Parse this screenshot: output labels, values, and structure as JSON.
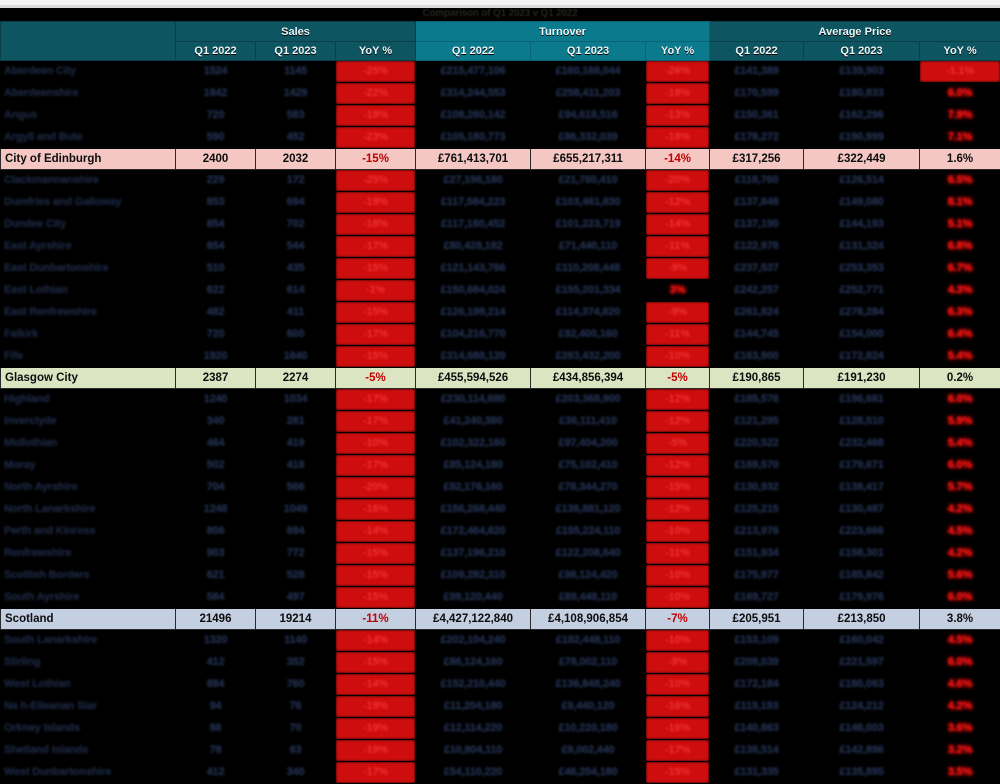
{
  "title": "Comparison of Q1 2023 v Q1 2022",
  "header": {
    "corner_label": "",
    "groups": [
      {
        "id": "sales",
        "label": "Sales"
      },
      {
        "id": "turnover",
        "label": "Turnover"
      },
      {
        "id": "average_price",
        "label": "Average Price"
      }
    ],
    "subcolumns": [
      "Q1 2022",
      "Q1 2023",
      "YoY %"
    ]
  },
  "colors": {
    "header_dark_teal": "#0d5560",
    "header_bright_teal": "#0b7a8c",
    "highlight_pink": "#f4c7c3",
    "highlight_green": "#dbe5c2",
    "highlight_blue": "#c5cfe2",
    "negative_red": "#c00000",
    "obscured_black": "#000000"
  },
  "rows": [
    {
      "type": "obscured",
      "name": "Aberdeen City",
      "cells": [
        "1524",
        "1145",
        "-25%",
        "£215,477,106",
        "£160,188,044",
        "-26%",
        "£141,389",
        "£139,903",
        "-1.1%"
      ]
    },
    {
      "type": "obscured",
      "name": "Aberdeenshire",
      "cells": [
        "1842",
        "1429",
        "-22%",
        "£314,244,553",
        "£258,411,203",
        "-18%",
        "£170,599",
        "£180,833",
        "6.0%"
      ]
    },
    {
      "type": "obscured",
      "name": "Angus",
      "cells": [
        "720",
        "583",
        "-19%",
        "£108,260,142",
        "£94,618,516",
        "-13%",
        "£150,361",
        "£162,296",
        "7.9%"
      ]
    },
    {
      "type": "obscured",
      "name": "Argyll and Bute",
      "cells": [
        "590",
        "452",
        "-23%",
        "£105,180,773",
        "£86,332,039",
        "-18%",
        "£178,272",
        "£190,999",
        "7.1%"
      ]
    },
    {
      "type": "highlight",
      "style": "pink",
      "name": "City of Edinburgh",
      "cells": [
        "2400",
        "2032",
        "-15%",
        "£761,413,701",
        "£655,217,311",
        "-14%",
        "£317,256",
        "£322,449",
        "1.6%"
      ]
    },
    {
      "type": "obscured",
      "name": "Clackmannanshire",
      "cells": [
        "229",
        "172",
        "-25%",
        "£27,196,180",
        "£21,760,410",
        "-20%",
        "£118,760",
        "£126,514",
        "6.5%"
      ]
    },
    {
      "type": "obscured",
      "name": "Dumfries and Galloway",
      "cells": [
        "853",
        "694",
        "-19%",
        "£117,584,223",
        "£103,461,830",
        "-12%",
        "£137,848",
        "£149,080",
        "8.1%"
      ]
    },
    {
      "type": "obscured",
      "name": "Dundee City",
      "cells": [
        "854",
        "702",
        "-18%",
        "£117,160,452",
        "£101,223,719",
        "-14%",
        "£137,190",
        "£144,193",
        "5.1%"
      ]
    },
    {
      "type": "obscured",
      "name": "East Ayrshire",
      "cells": [
        "654",
        "544",
        "-17%",
        "£80,428,182",
        "£71,440,110",
        "-11%",
        "£122,978",
        "£131,324",
        "6.8%"
      ]
    },
    {
      "type": "obscured",
      "name": "East Dunbartonshire",
      "cells": [
        "510",
        "435",
        "-15%",
        "£121,143,766",
        "£110,208,448",
        "-9%",
        "£237,537",
        "£253,353",
        "6.7%"
      ]
    },
    {
      "type": "obscured",
      "name": "East Lothian",
      "cells": [
        "622",
        "614",
        "-1%",
        "£150,684,024",
        "£155,201,334",
        "3%",
        "£242,257",
        "£252,771",
        "4.3%"
      ]
    },
    {
      "type": "obscured",
      "name": "East Renfrewshire",
      "cells": [
        "482",
        "411",
        "-15%",
        "£126,199,214",
        "£114,374,820",
        "-9%",
        "£261,824",
        "£278,284",
        "6.3%"
      ]
    },
    {
      "type": "obscured",
      "name": "Falkirk",
      "cells": [
        "720",
        "600",
        "-17%",
        "£104,216,770",
        "£92,400,160",
        "-11%",
        "£144,745",
        "£154,000",
        "6.4%"
      ]
    },
    {
      "type": "obscured",
      "name": "Fife",
      "cells": [
        "1920",
        "1640",
        "-15%",
        "£314,688,120",
        "£283,432,200",
        "-10%",
        "£163,900",
        "£172,824",
        "5.4%"
      ]
    },
    {
      "type": "highlight",
      "style": "green",
      "name": "Glasgow City",
      "cells": [
        "2387",
        "2274",
        "-5%",
        "£455,594,526",
        "£434,856,394",
        "-5%",
        "£190,865",
        "£191,230",
        "0.2%"
      ]
    },
    {
      "type": "obscured",
      "name": "Highland",
      "cells": [
        "1240",
        "1034",
        "-17%",
        "£230,114,880",
        "£203,368,900",
        "-12%",
        "£185,576",
        "£196,681",
        "6.0%"
      ]
    },
    {
      "type": "obscured",
      "name": "Inverclyde",
      "cells": [
        "340",
        "281",
        "-17%",
        "£41,240,380",
        "£36,111,410",
        "-12%",
        "£121,295",
        "£128,510",
        "5.9%"
      ]
    },
    {
      "type": "obscured",
      "name": "Midlothian",
      "cells": [
        "464",
        "419",
        "-10%",
        "£102,322,160",
        "£97,404,200",
        "-5%",
        "£220,522",
        "£232,468",
        "5.4%"
      ]
    },
    {
      "type": "obscured",
      "name": "Moray",
      "cells": [
        "502",
        "418",
        "-17%",
        "£85,124,180",
        "£75,102,410",
        "-12%",
        "£169,570",
        "£179,671",
        "6.0%"
      ]
    },
    {
      "type": "obscured",
      "name": "North Ayrshire",
      "cells": [
        "704",
        "566",
        "-20%",
        "£92,176,160",
        "£78,344,270",
        "-15%",
        "£130,932",
        "£138,417",
        "5.7%"
      ]
    },
    {
      "type": "obscured",
      "name": "North Lanarkshire",
      "cells": [
        "1248",
        "1049",
        "-16%",
        "£156,268,440",
        "£136,881,120",
        "-12%",
        "£125,215",
        "£130,487",
        "4.2%"
      ]
    },
    {
      "type": "obscured",
      "name": "Perth and Kinross",
      "cells": [
        "806",
        "694",
        "-14%",
        "£172,464,820",
        "£155,224,110",
        "-10%",
        "£213,976",
        "£223,666",
        "4.5%"
      ]
    },
    {
      "type": "obscured",
      "name": "Renfrewshire",
      "cells": [
        "903",
        "772",
        "-15%",
        "£137,196,210",
        "£122,208,640",
        "-11%",
        "£151,934",
        "£158,301",
        "4.2%"
      ]
    },
    {
      "type": "obscured",
      "name": "Scottish Borders",
      "cells": [
        "621",
        "528",
        "-15%",
        "£109,282,310",
        "£98,124,420",
        "-10%",
        "£175,977",
        "£185,842",
        "5.6%"
      ]
    },
    {
      "type": "obscured",
      "name": "South Ayrshire",
      "cells": [
        "584",
        "497",
        "-15%",
        "£99,120,440",
        "£89,448,110",
        "-10%",
        "£169,727",
        "£179,976",
        "6.0%"
      ]
    },
    {
      "type": "highlight",
      "style": "blue",
      "name": "Scotland",
      "cells": [
        "21496",
        "19214",
        "-11%",
        "£4,427,122,840",
        "£4,108,906,854",
        "-7%",
        "£205,951",
        "£213,850",
        "3.8%"
      ]
    },
    {
      "type": "obscured",
      "name": "South Lanarkshire",
      "cells": [
        "1320",
        "1140",
        "-14%",
        "£202,104,240",
        "£182,448,110",
        "-10%",
        "£153,109",
        "£160,042",
        "4.5%"
      ]
    },
    {
      "type": "obscured",
      "name": "Stirling",
      "cells": [
        "412",
        "352",
        "-15%",
        "£86,124,160",
        "£78,002,110",
        "-9%",
        "£209,039",
        "£221,597",
        "6.0%"
      ]
    },
    {
      "type": "obscured",
      "name": "West Lothian",
      "cells": [
        "884",
        "760",
        "-14%",
        "£152,210,440",
        "£136,848,240",
        "-10%",
        "£172,184",
        "£180,063",
        "4.6%"
      ]
    },
    {
      "type": "obscured",
      "name": "Na h-Eileanan Siar",
      "cells": [
        "94",
        "76",
        "-19%",
        "£11,204,180",
        "£9,440,120",
        "-16%",
        "£119,193",
        "£124,212",
        "4.2%"
      ]
    },
    {
      "type": "obscured",
      "name": "Orkney Islands",
      "cells": [
        "86",
        "70",
        "-19%",
        "£12,114,220",
        "£10,220,180",
        "-16%",
        "£140,863",
        "£146,003",
        "3.6%"
      ]
    },
    {
      "type": "obscured",
      "name": "Shetland Islands",
      "cells": [
        "78",
        "63",
        "-19%",
        "£10,804,110",
        "£9,002,440",
        "-17%",
        "£138,514",
        "£142,896",
        "3.2%"
      ]
    },
    {
      "type": "obscured",
      "name": "West Dunbartonshire",
      "cells": [
        "412",
        "340",
        "-17%",
        "£54,110,220",
        "£46,204,180",
        "-15%",
        "£131,335",
        "£135,895",
        "3.5%"
      ]
    }
  ]
}
